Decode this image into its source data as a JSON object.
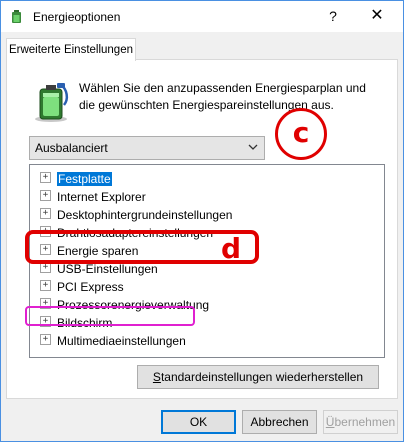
{
  "window": {
    "title": "Energieoptionen",
    "help_glyph": "?",
    "close_glyph": "✕"
  },
  "tab": {
    "label": "Erweiterte Einstellungen"
  },
  "description": "Wählen Sie den anzupassenden Energiesparplan und die gewünschten Energiespareinstellungen aus.",
  "plan_dropdown": {
    "selected": "Ausbalanciert"
  },
  "tree": {
    "items": [
      {
        "label": "Festplatte",
        "selected": true
      },
      {
        "label": "Internet Explorer",
        "selected": false
      },
      {
        "label": "Desktophintergrundeinstellungen",
        "selected": false
      },
      {
        "label": "Drahtlosadaptereinstellungen",
        "selected": false
      },
      {
        "label": "Energie sparen",
        "selected": false
      },
      {
        "label": "USB-Einstellungen",
        "selected": false
      },
      {
        "label": "PCI Express",
        "selected": false
      },
      {
        "label": "Prozessorenergieverwaltung",
        "selected": false
      },
      {
        "label": "Bildschirm",
        "selected": false
      },
      {
        "label": "Multimediaeinstellungen",
        "selected": false
      }
    ],
    "expander_glyph": "+"
  },
  "buttons": {
    "restore_prefix": "S",
    "restore_rest": "tandardeinstellungen wiederherstellen",
    "ok": "OK",
    "cancel": "Abbrechen",
    "apply_prefix": "Ü",
    "apply_rest": "bernehmen"
  },
  "annotations": {
    "c_label": "c",
    "d_label": "d",
    "c_color": "#e00000",
    "d_color": "#e00000",
    "pink_color": "#e020d0"
  },
  "colors": {
    "selection": "#0078d7",
    "window_border": "#4a90e2"
  }
}
